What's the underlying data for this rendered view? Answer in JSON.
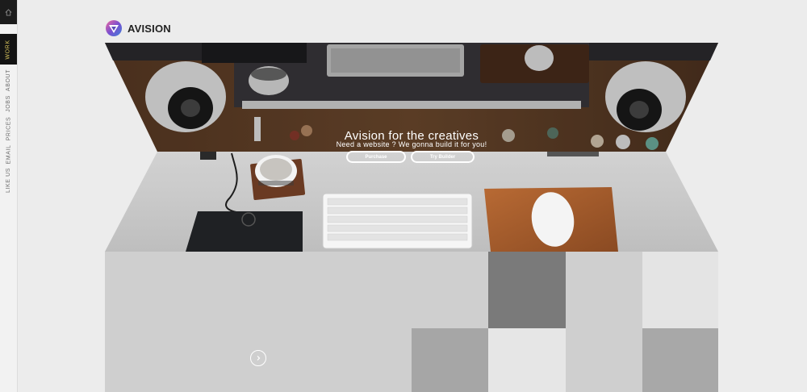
{
  "brand": {
    "name": "AVISION"
  },
  "sidebar": {
    "items": [
      {
        "label": "WORK",
        "active": true
      },
      {
        "label": "ABOUT"
      },
      {
        "label": "JOBS"
      },
      {
        "label": "PRICES"
      },
      {
        "label": "EMAIL"
      },
      {
        "label": "LIKE US"
      }
    ]
  },
  "hero": {
    "title": "Avision for the creatives",
    "subtitle": "Need a website ? We gonna build it for you!",
    "buttons": {
      "purchase": "Purchase",
      "try_builder": "Try Builder"
    }
  },
  "colors": {
    "background": "#ececec",
    "nav_active_bg": "#141414",
    "nav_active_text": "#d6c25a",
    "tile_light": "#cfcfcf",
    "tile_mid": "#a8a8a8",
    "tile_dark": "#7a7a7a",
    "tile_white": "#e6e6e6"
  }
}
